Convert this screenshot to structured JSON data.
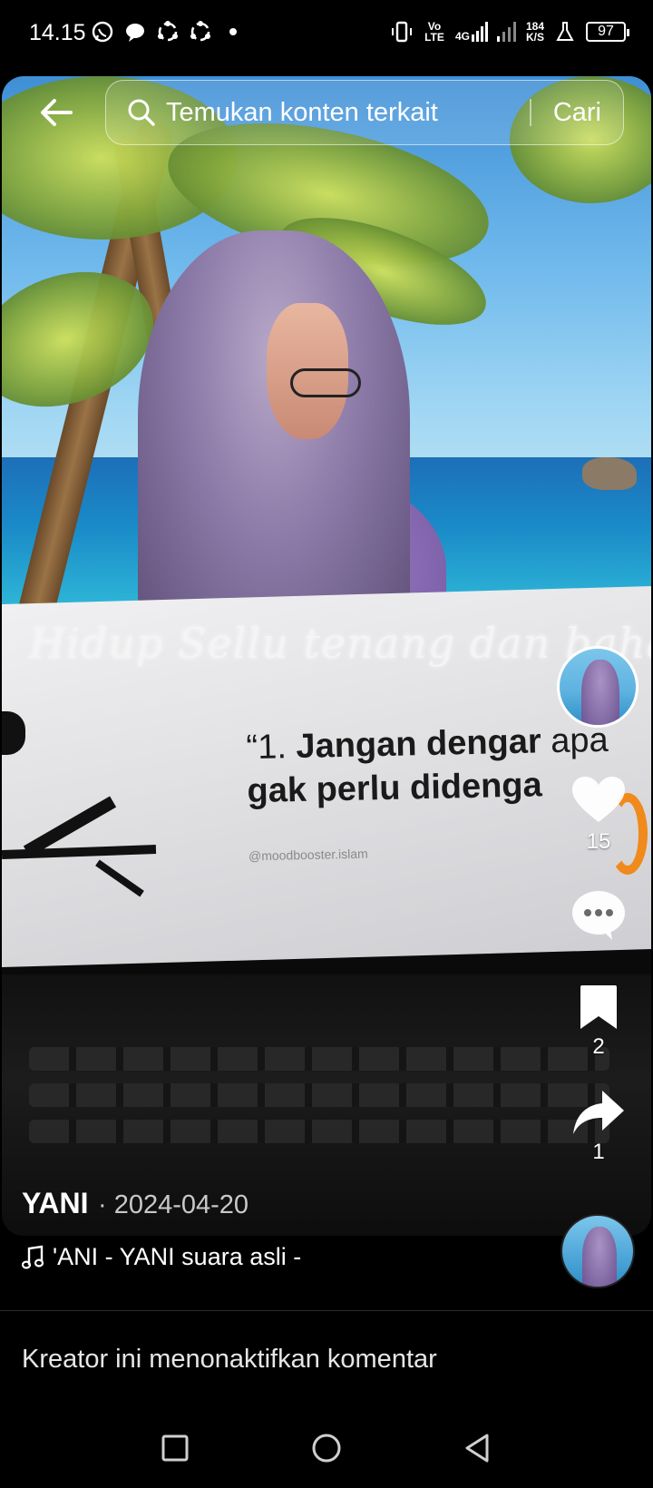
{
  "status_bar": {
    "time": "14.15",
    "network_volte": "Vo LTE",
    "network_4g": "4G",
    "speed_value": "184",
    "speed_unit": "K/S",
    "battery": "97"
  },
  "search": {
    "placeholder": "Temukan konten terkait",
    "button_label": "Cari"
  },
  "video": {
    "caption_script": "Hidup Sellu tenang dan bahag",
    "quote_prefix": "“1. ",
    "quote_line1_bold": "Jangan dengar",
    "quote_line1_rest": " apa",
    "quote_line2": "gak perlu didenga",
    "watermark": "@moodbooster.islam"
  },
  "actions": {
    "likes": "15",
    "saves": "2",
    "shares": "1"
  },
  "post": {
    "author": "YANI",
    "date": "· 2024-04-20",
    "music": "'ANI - YANI    suara asli -"
  },
  "comments": {
    "disabled_text": "Kreator ini menonaktifkan komentar"
  },
  "icons": {
    "status_left": [
      "whatsapp-icon",
      "chat-bubble-icon",
      "sync-icon",
      "sync-icon",
      "dot-icon"
    ],
    "status_right": [
      "vibrate-icon",
      "volte-icon",
      "signal-4g-icon",
      "signal-icon",
      "speed-icon",
      "lab-icon",
      "battery-icon"
    ]
  }
}
